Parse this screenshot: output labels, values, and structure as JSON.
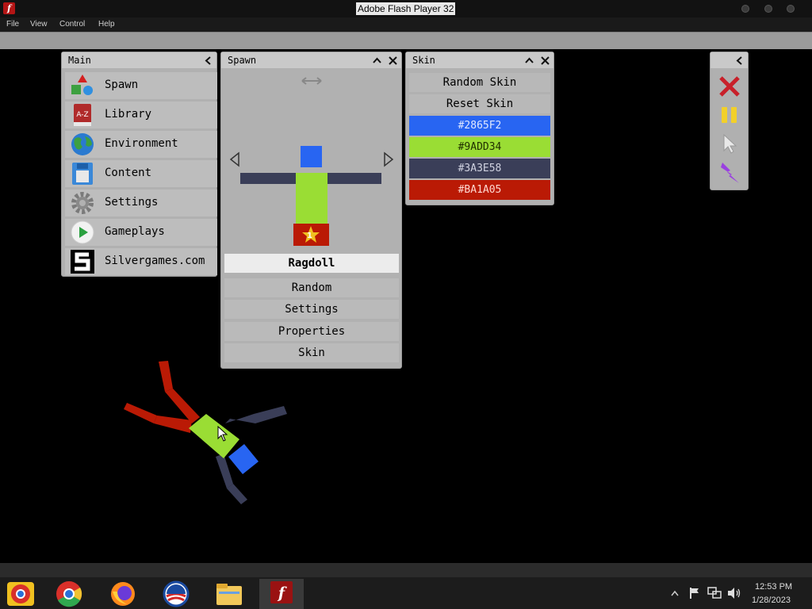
{
  "window": {
    "title": "Adobe Flash Player 32",
    "menu": [
      "File",
      "View",
      "Control",
      "Help"
    ]
  },
  "main_panel": {
    "title": "Main",
    "items": [
      {
        "label": "Spawn",
        "icon": "shapes-icon"
      },
      {
        "label": "Library",
        "icon": "a-z-book-icon"
      },
      {
        "label": "Environment",
        "icon": "globe-icon"
      },
      {
        "label": "Content",
        "icon": "floppy-disk-icon"
      },
      {
        "label": "Settings",
        "icon": "gear-icon"
      },
      {
        "label": "Gameplays",
        "icon": "play-icon"
      },
      {
        "label": "Silvergames.com",
        "icon": "silvergames-logo-icon"
      }
    ]
  },
  "spawn_panel": {
    "title": "Spawn",
    "selected": "Ragdoll",
    "options": [
      "Random",
      "Settings",
      "Properties",
      "Skin"
    ],
    "preview_badge": "1"
  },
  "skin_panel": {
    "title": "Skin",
    "random_label": "Random Skin",
    "reset_label": "Reset Skin",
    "colors": [
      {
        "label": "#2865F2",
        "hex": "#2865F2",
        "text": "#e0e8ff"
      },
      {
        "label": "#9ADD34",
        "hex": "#9ADD34",
        "text": "#203000"
      },
      {
        "label": "#3A3E58",
        "hex": "#3A3E58",
        "text": "#d0d2e0"
      },
      {
        "label": "#BA1A05",
        "hex": "#BA1A05",
        "text": "#ffd8d0"
      }
    ]
  },
  "tools_panel": {
    "tools": [
      "close-x-icon",
      "pause-icon",
      "pointer-icon",
      "lightning-icon"
    ]
  },
  "taskbar": {
    "apps": [
      "chrome-canary-icon",
      "chrome-icon",
      "firefox-icon",
      "obama-logo-icon",
      "file-explorer-icon",
      "flash-player-icon"
    ],
    "time": "12:53 PM",
    "date": "1/28/2023"
  }
}
